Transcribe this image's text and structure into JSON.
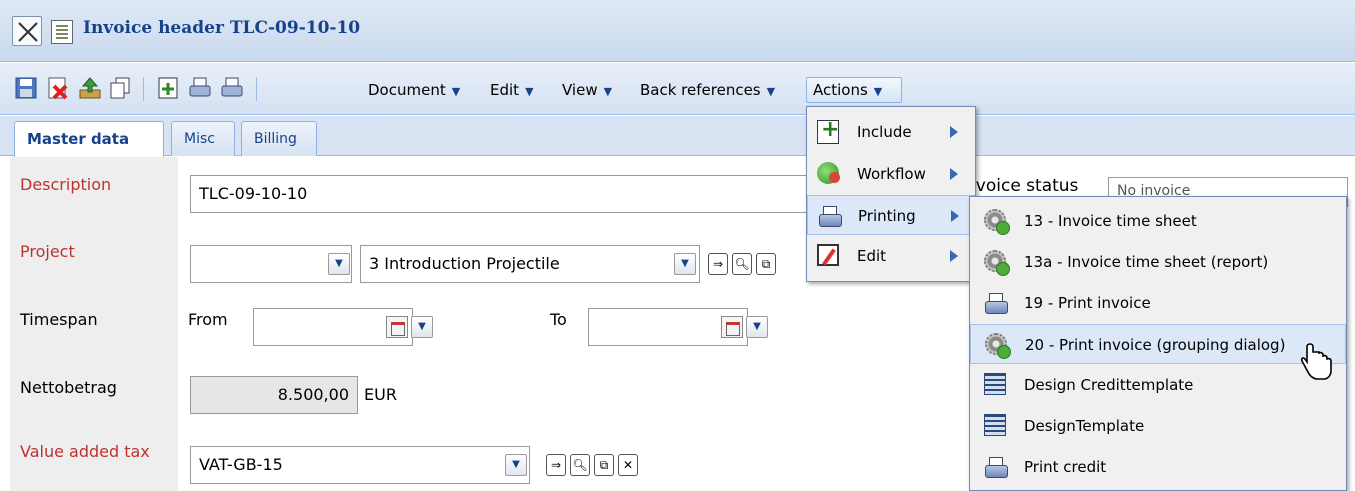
{
  "window": {
    "title": "Invoice header TLC-09-10-10"
  },
  "toolbar": {
    "icons": [
      "save-icon",
      "delete-icon",
      "upload-icon",
      "copy-icon",
      "include-icon",
      "print-icon",
      "print-preview-icon"
    ],
    "menus": [
      {
        "label": "Document"
      },
      {
        "label": "Edit"
      },
      {
        "label": "View"
      },
      {
        "label": "Back references"
      },
      {
        "label": "Actions"
      }
    ]
  },
  "tabs": [
    {
      "label": "Master data",
      "active": true
    },
    {
      "label": "Misc"
    },
    {
      "label": "Billing"
    }
  ],
  "form": {
    "description": {
      "label": "Description",
      "value": "TLC-09-10-10"
    },
    "project": {
      "label": "Project",
      "value": "3 Introduction Projectile"
    },
    "timespan": {
      "label": "Timespan",
      "from_label": "From",
      "to_label": "To"
    },
    "netto": {
      "label": "Nettobetrag",
      "value": "8.500,00",
      "currency": "EUR"
    },
    "vat": {
      "label": "Value added tax",
      "value": "VAT-GB-15"
    },
    "invoice_status": {
      "label": "Invoice status",
      "value": "No invoice"
    }
  },
  "actions_menu": {
    "items": [
      {
        "label": "Include",
        "icon": "include-icon"
      },
      {
        "label": "Workflow",
        "icon": "workflow-icon"
      },
      {
        "label": "Printing",
        "icon": "printer-icon",
        "highlighted": true
      },
      {
        "label": "Edit",
        "icon": "edit-icon"
      }
    ]
  },
  "printing_menu": {
    "items": [
      {
        "label": "13 - Invoice time sheet",
        "icon": "gear-icon"
      },
      {
        "label": "13a - Invoice time sheet (report)",
        "icon": "gear-icon"
      },
      {
        "label": "19 - Print invoice",
        "icon": "printer-icon"
      },
      {
        "label": "20 - Print invoice (grouping dialog)",
        "icon": "gear-icon",
        "highlighted": true
      },
      {
        "label": "Design Credittemplate",
        "icon": "template-icon"
      },
      {
        "label": "DesignTemplate",
        "icon": "template-icon"
      },
      {
        "label": "Print credit",
        "icon": "printer-icon"
      }
    ]
  },
  "colors": {
    "title_text": "#15428b",
    "required_label": "#c03030",
    "menu_highlight": "#dce8f7"
  }
}
